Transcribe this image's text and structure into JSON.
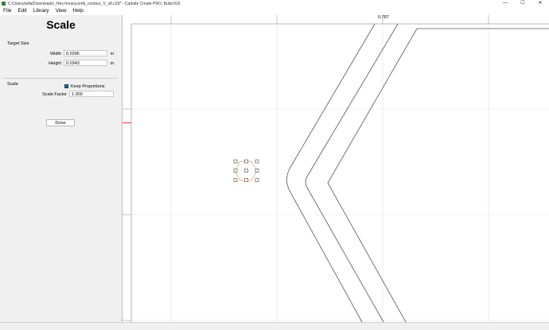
{
  "window": {
    "title": "C:/Users/willa/Downloads/_Hex-honeycomb_contour_V_v8.c2d* - Carbide Create PRO, Build 816",
    "minimize_glyph": "—",
    "maximize_glyph": "☐",
    "close_glyph": "✕"
  },
  "menu": {
    "items": [
      "File",
      "Edit",
      "Library",
      "View",
      "Help"
    ]
  },
  "panel": {
    "title": "Scale",
    "target_size_label": "Target Size",
    "width_label": "Width",
    "width_value": "0.0396",
    "width_unit": "in",
    "height_label": "Height",
    "height_value": "0.0343",
    "height_unit": "in",
    "keep_proportions_label": "Keep Proportions",
    "keep_proportions_checked": true,
    "scale_section_label": "Scale",
    "scale_factor_label": "Scale Factor",
    "scale_factor_value": "1.000",
    "done_label": "Done"
  },
  "canvas": {
    "ruler_top_label": "0.787",
    "indicator_color": "#e53935",
    "selection_color": "#e3a35b"
  }
}
